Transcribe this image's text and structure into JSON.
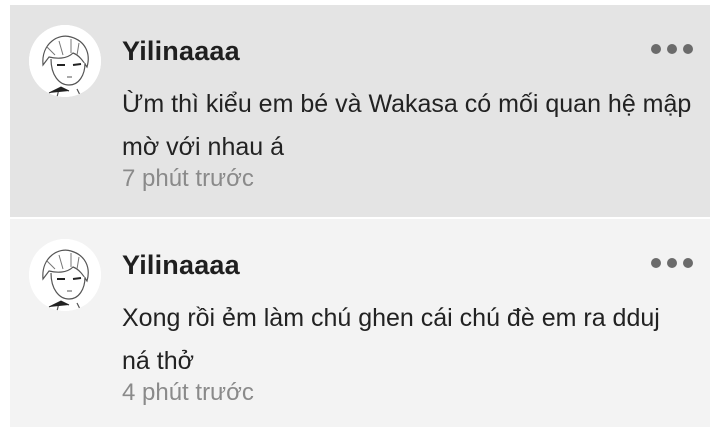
{
  "comments": [
    {
      "author": "Yilinaaaa",
      "text": "Ừm thì kiểu em bé và Wakasa có mối quan hệ mập mờ với nhau á",
      "time": "7 phút trước",
      "more_icon": "more-horizontal-icon"
    },
    {
      "author": "Yilinaaaa",
      "text": "Xong rồi ẻm làm chú ghen cái chú đè em ra dduj ná thở",
      "time": "4 phút trước",
      "more_icon": "more-horizontal-icon"
    }
  ],
  "colors": {
    "highlighted_bg": "#e4e4e4",
    "normal_bg": "#f3f3f3",
    "author": "#1f1f1f",
    "timestamp": "#8a8a8a"
  }
}
